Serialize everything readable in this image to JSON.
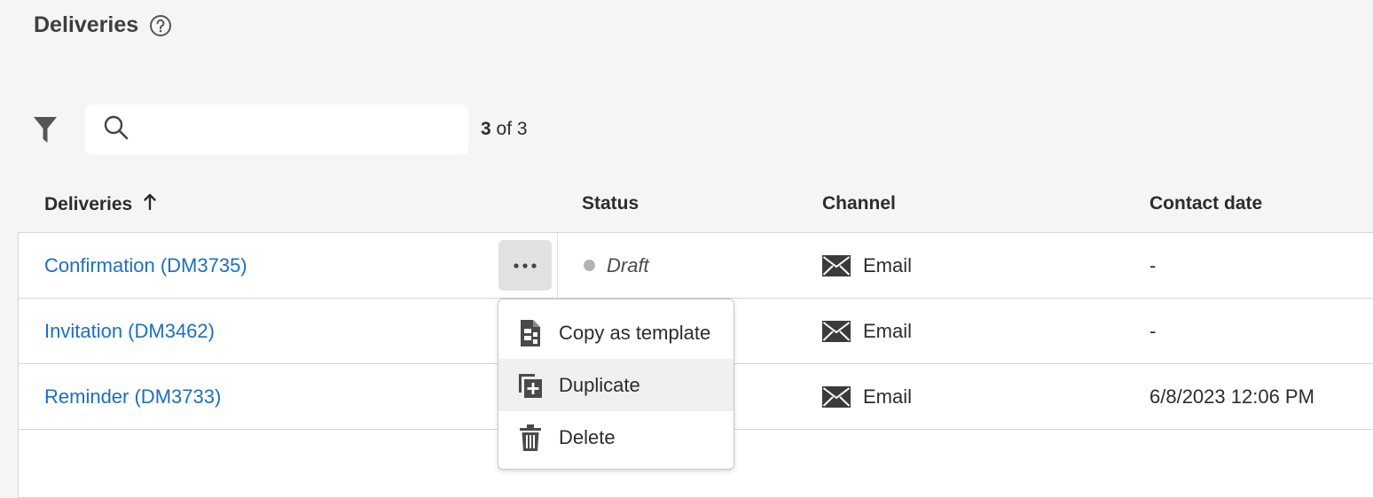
{
  "page": {
    "title": "Deliveries",
    "help_icon": "help-circle-icon"
  },
  "toolbar": {
    "filter_icon": "filter-icon",
    "search_placeholder": "",
    "search_value": "",
    "count_shown": "3",
    "count_rest": " of 3"
  },
  "columns": {
    "deliveries": "Deliveries",
    "status": "Status",
    "channel": "Channel",
    "contact_date": "Contact date"
  },
  "rows": [
    {
      "name": "Confirmation (DM3735)",
      "status": "Draft",
      "channel": "Email",
      "contact_date": "-"
    },
    {
      "name": "Invitation (DM3462)",
      "status": "",
      "channel": "Email",
      "contact_date": "-"
    },
    {
      "name": "Reminder (DM3733)",
      "status": "",
      "channel": "Email",
      "contact_date": "6/8/2023 12:06 PM"
    }
  ],
  "context_menu": {
    "items": [
      {
        "label": "Copy as template",
        "icon": "copy-template-icon"
      },
      {
        "label": "Duplicate",
        "icon": "duplicate-icon"
      },
      {
        "label": "Delete",
        "icon": "trash-icon"
      }
    ]
  },
  "colors": {
    "link": "#1a6fc4",
    "background": "#f5f5f5",
    "status_dot": "#b3b3b3"
  }
}
